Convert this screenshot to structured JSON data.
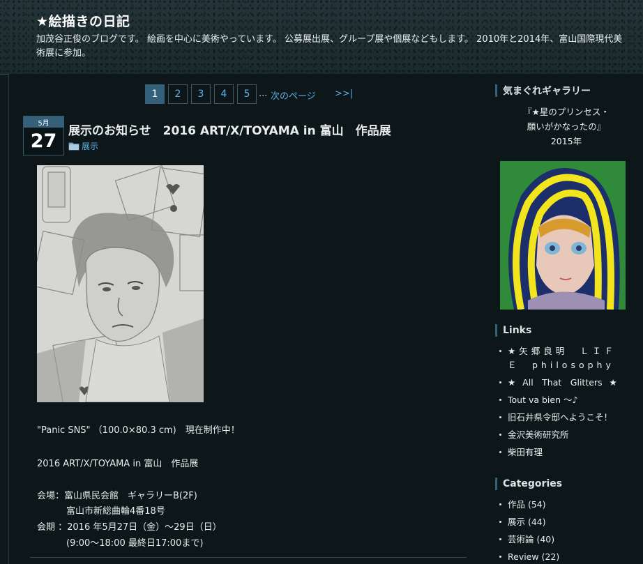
{
  "header": {
    "title": "★絵描きの日記",
    "description": "加茂谷正俊のブログです。 絵画を中心に美術やっています。 公募展出展、グループ展や個展などもします。 2010年と2014年、富山国際現代美術展に参加。"
  },
  "pager": {
    "pages": [
      "1",
      "2",
      "3",
      "4",
      "5"
    ],
    "current": "1",
    "ellipsis": "...",
    "next_label": "次のページ",
    "last_label": ">>|"
  },
  "post": {
    "month": "5月",
    "day": "27",
    "title": "展示のお知らせ　2016 ART/X/TOYAMA in 富山　作品展",
    "category": "展示",
    "image_icon": "pencil-portrait-artwork",
    "lines": [
      "\"Panic SNS\" （100.0×80.3 cm)　現在制作中！",
      "2016 ART/X/TOYAMA in 富山　作品展",
      "会場：富山県民会館　ギャラリーB(2F)",
      "富山市新総曲輪4番18号",
      "会期 ：2016 年5月27日（金）〜29日（日）",
      "(9:00〜18:00 最終日17:00まで)"
    ]
  },
  "sidebar": {
    "gallery": {
      "title": "気まぐれギャラリー",
      "caption": [
        "『★星のプリンセス・",
        "願いがかなったの』",
        "2015年"
      ]
    },
    "links": {
      "title": "Links",
      "items": [
        "★矢郷良明　ＬＩＦＥ　philosophy",
        "★ All　That　Glitters ★",
        "Tout va bien 〜♪",
        "旧石井県令邸へようこそ！",
        "金沢美術研究所",
        "柴田有理"
      ]
    },
    "categories": {
      "title": "Categories",
      "items": [
        "作品 (54)",
        "展示 (44)",
        "芸術論 (40)",
        "Review (22)"
      ]
    }
  },
  "colors": {
    "accent": "#34607a",
    "link": "#5ab0e8",
    "background": "#0d1719"
  }
}
